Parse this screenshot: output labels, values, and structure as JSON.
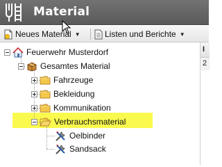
{
  "app": {
    "title": "Material"
  },
  "toolbar": {
    "new_label": "Neues Material",
    "lists_label": "Listen und Berichte"
  },
  "tree": {
    "root": {
      "label": "Feuerwehr Musterdorf",
      "icon": "home-icon"
    },
    "all": {
      "label": "Gesamtes Material",
      "icon": "package-icon"
    },
    "categories": [
      {
        "label": "Fahrzeuge",
        "icon": "folder-icon",
        "expanded": false
      },
      {
        "label": "Bekleidung",
        "icon": "folder-icon",
        "expanded": false
      },
      {
        "label": "Kommunikation",
        "icon": "folder-icon",
        "expanded": false
      },
      {
        "label": "Verbrauchsmaterial",
        "icon": "folder-open-icon",
        "expanded": true,
        "highlighted": true
      }
    ],
    "items": [
      {
        "label": "Oelbinder",
        "icon": "tools-icon"
      },
      {
        "label": "Sandsack",
        "icon": "tools-icon"
      }
    ]
  },
  "right_panel": {
    "header": "I",
    "cell": "2"
  },
  "colors": {
    "titlebar": "#666666",
    "highlight": "#fafa4e",
    "folder": "#f3c84b"
  }
}
